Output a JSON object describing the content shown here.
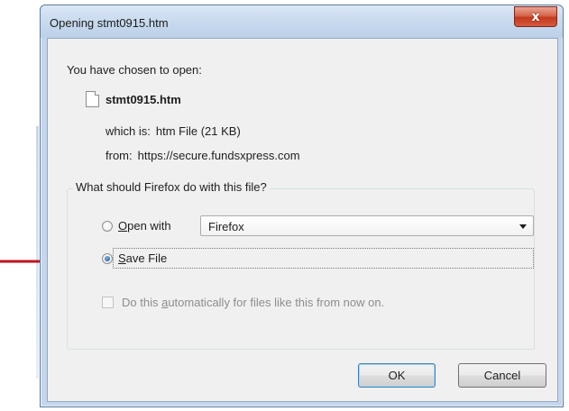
{
  "window": {
    "title": "Opening stmt0915.htm",
    "close_symbol": "x"
  },
  "dialog": {
    "heading": "You have chosen to open:",
    "file": {
      "icon": "document-icon",
      "name": "stmt0915.htm"
    },
    "which_is": {
      "label": "which is:",
      "value": "htm File (21 KB)"
    },
    "from": {
      "label": "from:",
      "value": "https://secure.fundsxpress.com"
    }
  },
  "action_group": {
    "legend": "What should Firefox do with this file?",
    "open_with": {
      "label_underlined": "O",
      "label_rest": "pen with",
      "selected": false,
      "app_select_value": "Firefox"
    },
    "save_file": {
      "label_underlined": "S",
      "label_rest": "ave File",
      "selected": true
    },
    "auto_checkbox": {
      "label_before": "Do this ",
      "label_underlined": "a",
      "label_after": "utomatically for files like this from now on.",
      "checked": false,
      "enabled": false
    }
  },
  "buttons": {
    "ok": "OK",
    "cancel": "Cancel"
  },
  "annotation": {
    "arrow_color": "#c0111f"
  }
}
